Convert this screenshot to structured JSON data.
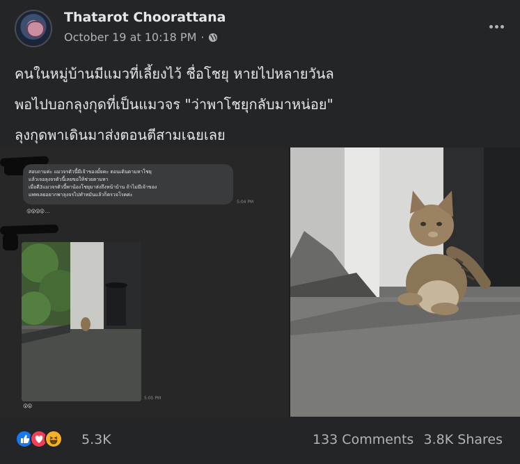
{
  "post": {
    "author": "Thatarot Choorattana",
    "timestamp": "October 19 at 10:18 PM",
    "separator": "·",
    "privacy_icon": "globe-icon",
    "more_icon": "more-horizontal-icon",
    "text_lines": [
      "คนในหมู่บ้านมีแมวที่เลี้ยงไว้ ชื่อโชยุ หายไปหลายวันล",
      "พอไปบอกลุงกุดที่เป็นแมวจร \"ว่าพาโชยุกลับมาหน่อย\"",
      "ลุงกุดพาเดินมาส่งตอนตีสามเฉยเลย"
    ]
  },
  "media": {
    "chat": {
      "message": "สอบถามค่ะ แมวจรตัวนี้มีเจ้าของมั้ยคะ ตอนเดินตามหาโชยุ\nแล้วเจอลุงจรตัวนี้เลยขอให้ช่วยตามหา\nเมื่อตี3แมวจรตัวนี้พาน้องโชยุมาส่งถึงหน้าบ้าน ถ้าไม่มีเจ้าของ\nแพทเลยอยากพาลุงจรไปทำหมันแล้วก็ตรวจโรคค่ะ",
      "time1": "5:04 PM",
      "reactions1": "😲😲😲😲 …",
      "time2": "5:05 PM",
      "reactions2": "😲😲"
    }
  },
  "footer": {
    "reactions": [
      "like-icon",
      "love-icon",
      "haha-icon"
    ],
    "reaction_count": "5.3K",
    "comments": "133 Comments",
    "shares": "3.8K Shares"
  },
  "colors": {
    "background": "#242526",
    "text_primary": "#e4e6eb",
    "text_secondary": "#b0b3b8",
    "like": "#1877f2",
    "love": "#f33e58",
    "haha": "#f7b125"
  }
}
